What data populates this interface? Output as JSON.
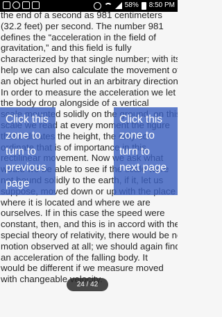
{
  "status_bar": {
    "battery_percent": "58%",
    "time": "8:50 PM"
  },
  "page_text": [
    "the end of a second as 981 centimeters",
    "(32.2 feet) per second. The number 981",
    "defines the “acceleration in the field of",
    "gravitation,” and this field is fully",
    "characterized by that single number; with its",
    "help we can also calculate the movement of",
    "an object hurled out in an arbitrary direction.",
    "In order to measure the acceleration we let",
    "the body drop alongside of a vertical",
    "scale mounted solidly on the ground, on this",
    "scale we read at every moment the figure",
    "that indicates the height, the only co-",
    "ordinate that is of importance in this",
    "rectilinear movement. Now we ask what",
    "would we be able to see if the scale were",
    "not bound solidly to the earth, if it, let us",
    "suppose, moved down or up with the place",
    "where it is located and where we are",
    "ourselves. If in this case the speed were",
    "constant, then, and this is in accord with the",
    "special theory of relativity, there would be no",
    "motion observed at all; we should again find",
    "an acceleration of the falling body. It",
    "would be different if we measure moved",
    "with changeable velocity."
  ],
  "zones": {
    "left_label": "Click this zone to turn to previous page",
    "right_label": "Click this zone to turn to next page"
  },
  "page_indicator": "24 / 42"
}
